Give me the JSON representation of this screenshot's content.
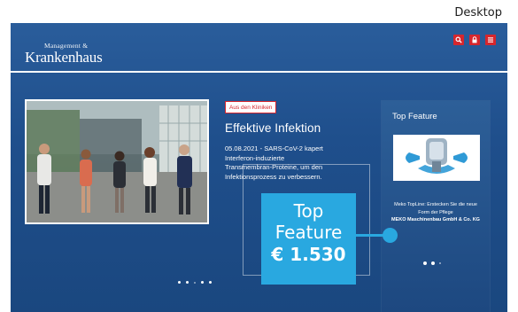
{
  "viewport_label": "Desktop",
  "header": {
    "logo_small": "Management &",
    "logo_main": "Krankenhaus",
    "icons": [
      "search-icon",
      "lock-icon",
      "menu-icon"
    ],
    "accent_color": "#d6262d"
  },
  "hero": {
    "category": "Aus den Kliniken",
    "title": "Effektive Infektion",
    "body_lines": [
      "05.08.2021 -  SARS-CoV-2 kapert",
      "Interferon-induzierte",
      "Transmembran-Proteine, um den",
      "Infektionsprozess zu verbessern."
    ],
    "image": "group-photo-five-people"
  },
  "feature": {
    "heading": "Top Feature",
    "image": "fluid-pump-product",
    "description": "Meko TopLine: Erstecken Sie die neue Form der Pflege",
    "company": "MEKO Maschinenbau GmbH & Co. KG"
  },
  "price_overlay": {
    "title_line1": "Top",
    "title_line2": "Feature",
    "price": "€ 1.530",
    "color": "#29a8e0"
  }
}
